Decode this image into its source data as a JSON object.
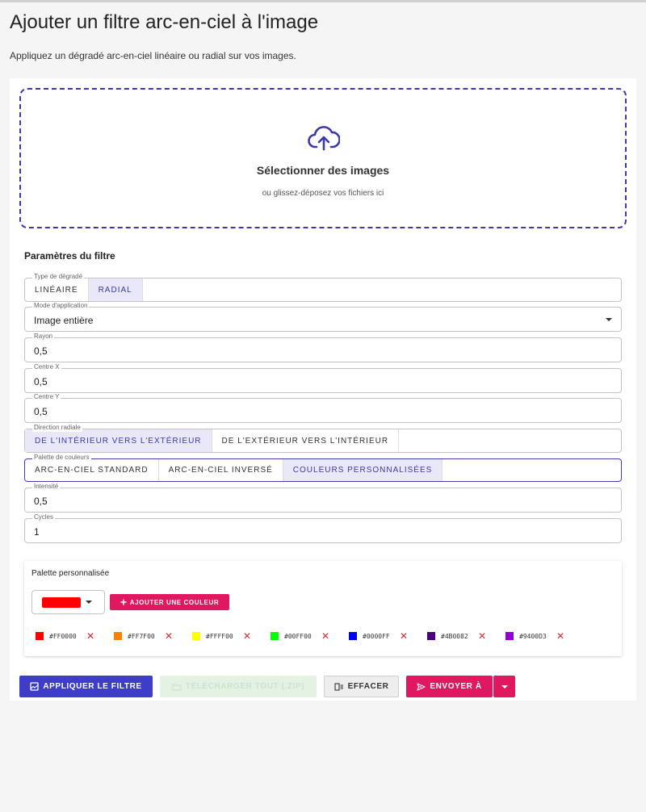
{
  "page": {
    "title": "Ajouter un filtre arc-en-ciel à l'image",
    "subtitle": "Appliquez un dégradé arc-en-ciel linéaire ou radial sur vos images."
  },
  "dropzone": {
    "title": "Sélectionner des images",
    "subtitle": "ou glissez-déposez vos fichiers ici",
    "icon": "cloud-upload-icon"
  },
  "settings": {
    "title": "Paramètres du filtre",
    "gradient_type": {
      "label": "Type de dégradé",
      "options": [
        "LINÉAIRE",
        "RADIAL"
      ],
      "selected": "RADIAL"
    },
    "application_mode": {
      "label": "Mode d'application",
      "value": "Image entière"
    },
    "radius": {
      "label": "Rayon",
      "value": "0,5"
    },
    "center_x": {
      "label": "Centre X",
      "value": "0,5"
    },
    "center_y": {
      "label": "Centre Y",
      "value": "0,5"
    },
    "radial_direction": {
      "label": "Direction radiale",
      "options": [
        "DE L'INTÉRIEUR VERS L'EXTÉRIEUR",
        "DE L'EXTÉRIEUR VERS L'INTÉRIEUR"
      ],
      "selected": "DE L'INTÉRIEUR VERS L'EXTÉRIEUR"
    },
    "color_palette": {
      "label": "Palette de couleurs",
      "options": [
        "ARC-EN-CIEL STANDARD",
        "ARC-EN-CIEL INVERSÉ",
        "COULEURS PERSONNALISÉES"
      ],
      "selected": "COULEURS PERSONNALISÉES"
    },
    "intensity": {
      "label": "Intensité",
      "value": "0,5"
    },
    "cycles": {
      "label": "Cycles",
      "value": "1"
    }
  },
  "custom_palette": {
    "title": "Palette personnalisée",
    "picker_color": "#FF0000",
    "add_label": "AJOUTER UNE COULEUR",
    "colors": [
      "#FF0000",
      "#FF7F00",
      "#FFFF00",
      "#00FF00",
      "#0000FF",
      "#4B0082",
      "#9400D3"
    ]
  },
  "actions": {
    "apply": "APPLIQUER LE FILTRE",
    "download": "TÉLÉCHARGER TOUT (.ZIP)",
    "clear": "EFFACER",
    "send": "ENVOYER À"
  },
  "colors": {
    "accent": "#3d3dc9",
    "pink": "#e0185f",
    "remove": "#d32f2f"
  }
}
